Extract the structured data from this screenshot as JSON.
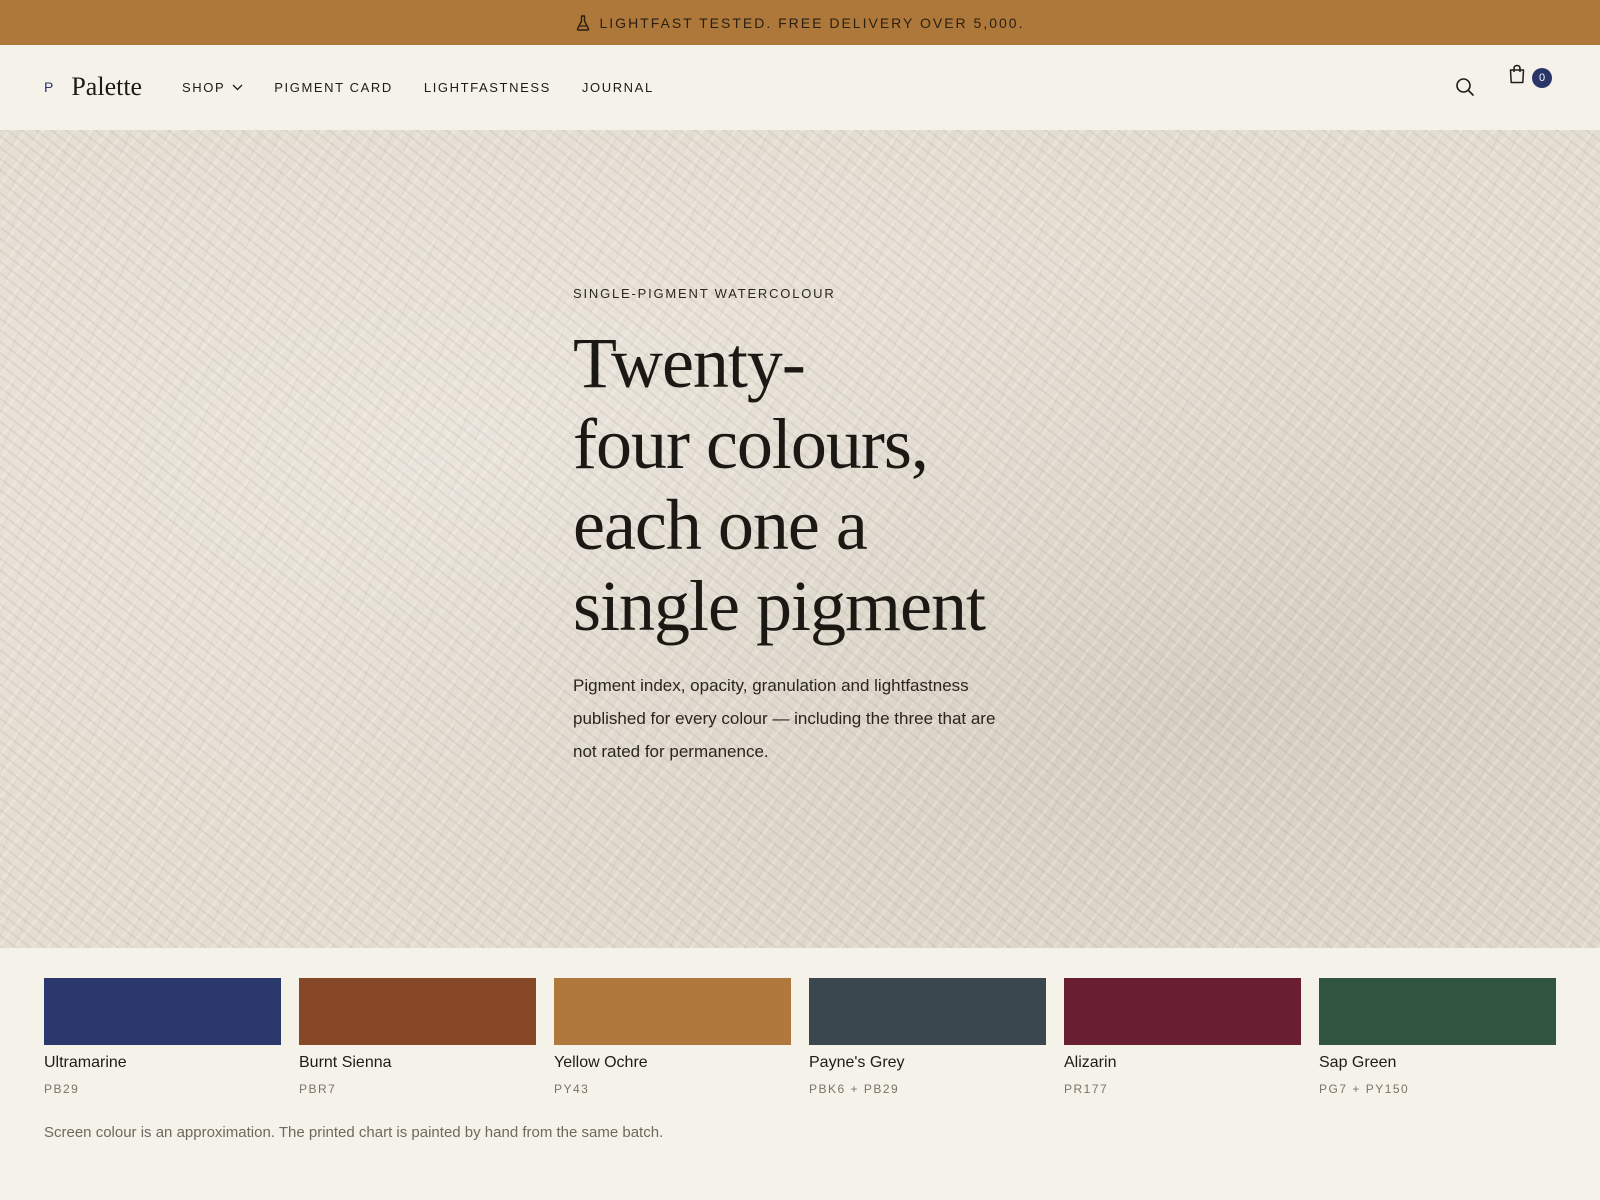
{
  "announcement": {
    "icon": "flask-icon",
    "text": "LIGHTFAST TESTED. FREE DELIVERY OVER 5,000."
  },
  "header": {
    "logo_mark": "P",
    "logo_name": "Palette",
    "nav": [
      {
        "label": "SHOP",
        "has_dropdown": true
      },
      {
        "label": "PIGMENT CARD"
      },
      {
        "label": "LIGHTFASTNESS"
      },
      {
        "label": "JOURNAL"
      }
    ],
    "search_icon": "search-icon",
    "cart_icon": "shopping-bag-icon",
    "cart_count": "0"
  },
  "hero": {
    "eyebrow": "SINGLE-PIGMENT WATERCOLOUR",
    "headline_lines": [
      "Twenty-",
      "four colours,",
      "each one a",
      "single pigment"
    ],
    "subtext": "Pigment index, opacity, granulation and lightfastness published for every colour — including the three that are not rated for permanence."
  },
  "swatches": [
    {
      "name": "Ultramarine",
      "code": "PB29",
      "color": "#2b386b"
    },
    {
      "name": "Burnt Sienna",
      "code": "PBR7",
      "color": "#874828"
    },
    {
      "name": "Yellow Ochre",
      "code": "PY43",
      "color": "#b0783c"
    },
    {
      "name": "Payne's Grey",
      "code": "PBK6 + PB29",
      "color": "#3b474e"
    },
    {
      "name": "Alizarin",
      "code": "PR177",
      "color": "#6a1e32"
    },
    {
      "name": "Sap Green",
      "code": "PG7 + PY150",
      "color": "#305440"
    }
  ],
  "note": "Screen colour is an approximation. The printed chart is painted by hand from the same batch.",
  "colors": {
    "announcement_bg": "#ad7839",
    "page_bg": "#f5f2ea",
    "accent": "#2a3568"
  }
}
